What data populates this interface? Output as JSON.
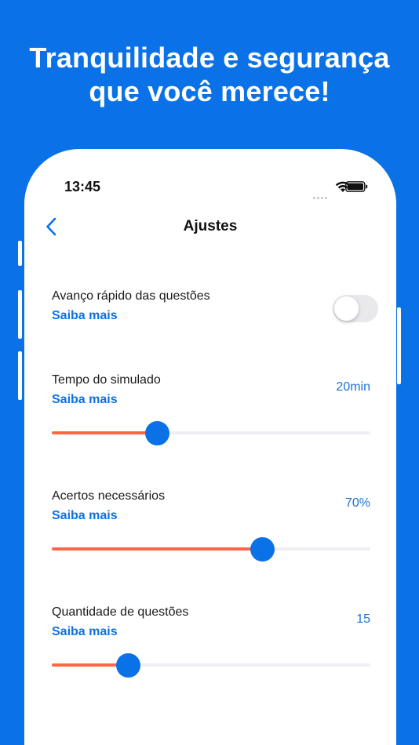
{
  "headline": {
    "line1": "Tranquilidade e segurança",
    "line2": "que você merece!"
  },
  "status_bar": {
    "time": "13:45",
    "icons": [
      "signal-icon",
      "wifi-icon",
      "battery-icon"
    ]
  },
  "nav": {
    "title": "Ajustes",
    "back_icon": "chevron-left-icon"
  },
  "settings": {
    "fast_advance": {
      "label": "Avanço rápido das questões",
      "link": "Saiba mais",
      "enabled": false
    },
    "exam_time": {
      "label": "Tempo do simulado",
      "link": "Saiba mais",
      "value": "20min",
      "level": 0.33
    },
    "required_correct": {
      "label": "Acertos necessários",
      "link": "Saiba mais",
      "value": "70%",
      "level": 0.66
    },
    "question_count": {
      "label": "Quantidade de questões",
      "link": "Saiba mais",
      "value": "15",
      "level": 0.24
    }
  },
  "colors": {
    "background": "#0a72e6",
    "accent": "#0a72e6",
    "slider_fill": "#ff6647",
    "slider_track": "#eeeef3",
    "toggle_off": "#e9e9eb"
  }
}
